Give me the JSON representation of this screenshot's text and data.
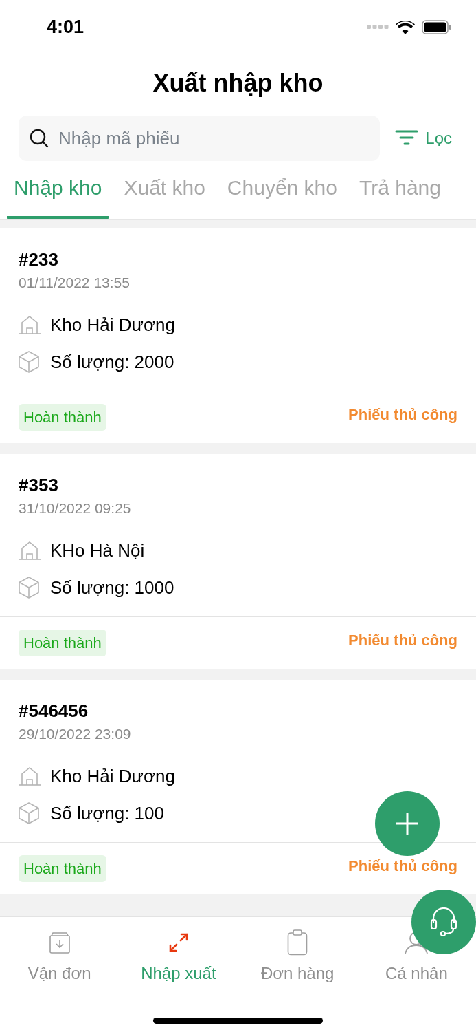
{
  "status_bar": {
    "time": "4:01"
  },
  "title": "Xuất nhập kho",
  "search": {
    "placeholder": "Nhập mã phiếu"
  },
  "filter": {
    "label": "Lọc"
  },
  "tabs": [
    {
      "label": "Nhập kho",
      "selected": true
    },
    {
      "label": "Xuất kho",
      "selected": false
    },
    {
      "label": "Chuyển kho",
      "selected": false
    },
    {
      "label": "Trả hàng",
      "selected": false
    }
  ],
  "records": [
    {
      "code": "#233",
      "datetime": "01/11/2022 13:55",
      "warehouse": "Kho Hải Dương",
      "quantity": "Số lượng: 2000",
      "status": "Hoàn thành",
      "type": "Phiếu thủ công"
    },
    {
      "code": "#353",
      "datetime": "31/10/2022 09:25",
      "warehouse": "KHo Hà Nội",
      "quantity": "Số lượng: 1000",
      "status": "Hoàn thành",
      "type": "Phiếu thủ công"
    },
    {
      "code": "#546456",
      "datetime": "29/10/2022 23:09",
      "warehouse": "Kho Hải Dương",
      "quantity": "Số lượng: 100",
      "status": "Hoàn thành",
      "type": "Phiếu thủ công"
    }
  ],
  "bottom_nav": [
    {
      "label": "Vận đơn",
      "selected": false
    },
    {
      "label": "Nhập xuất",
      "selected": true
    },
    {
      "label": "Đơn hàng",
      "selected": false
    },
    {
      "label": "Cá nhân",
      "selected": false
    }
  ]
}
